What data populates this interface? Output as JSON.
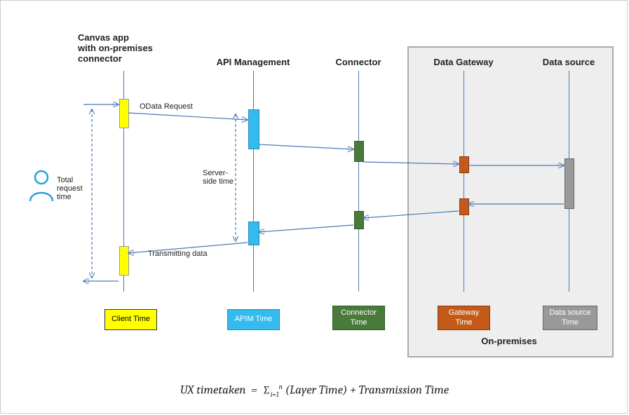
{
  "headers": {
    "canvas": "Canvas app\nwith on-premises\nconnector",
    "apim": "API Management",
    "connector": "Connector",
    "gateway": "Data Gateway",
    "datasource": "Data source"
  },
  "labels": {
    "odata_request": "OData Request",
    "server_side_time": "Server-\nside time",
    "total_request_time": "Total\nrequest\ntime",
    "transmitting_data": "Transmitting data",
    "on_premises": "On-premises"
  },
  "legends": {
    "client": "Client Time",
    "apim": "APIM Time",
    "connector": "Connector\nTime",
    "gateway": "Gateway\nTime",
    "datasource": "Data source\nTime"
  },
  "formula": {
    "lhs": "UX timetaken",
    "eq": "=",
    "sum_lower": "i=1",
    "sum_upper": "n",
    "term1": "(Layer Time)",
    "plus": "+",
    "term2": "Transmission Time"
  },
  "chart_data": {
    "type": "sequence-diagram",
    "participants": [
      {
        "id": "client",
        "label": "Canvas app with on-premises connector",
        "color": "#ffff00",
        "legend": "Client Time"
      },
      {
        "id": "apim",
        "label": "API Management",
        "color": "#33bbee",
        "legend": "APIM Time"
      },
      {
        "id": "connector",
        "label": "Connector",
        "color": "#4a7a3a",
        "legend": "Connector Time"
      },
      {
        "id": "gateway",
        "label": "Data Gateway",
        "color": "#c45a1a",
        "legend": "Gateway Time",
        "group": "on-premises"
      },
      {
        "id": "datasource",
        "label": "Data source",
        "color": "#999",
        "legend": "Data source Time",
        "group": "on-premises"
      }
    ],
    "group": {
      "id": "on-premises",
      "label": "On-premises"
    },
    "messages": [
      {
        "from": "user",
        "to": "client",
        "label": "",
        "direction": "request"
      },
      {
        "from": "client",
        "to": "apim",
        "label": "OData Request",
        "direction": "request"
      },
      {
        "from": "apim",
        "to": "connector",
        "label": "",
        "direction": "request"
      },
      {
        "from": "connector",
        "to": "gateway",
        "label": "",
        "direction": "request"
      },
      {
        "from": "gateway",
        "to": "datasource",
        "label": "",
        "direction": "request"
      },
      {
        "from": "datasource",
        "to": "gateway",
        "label": "",
        "direction": "response"
      },
      {
        "from": "gateway",
        "to": "connector",
        "label": "",
        "direction": "response"
      },
      {
        "from": "connector",
        "to": "apim",
        "label": "",
        "direction": "response"
      },
      {
        "from": "apim",
        "to": "client",
        "label": "Transmitting data",
        "direction": "response"
      },
      {
        "from": "client",
        "to": "user",
        "label": "",
        "direction": "response"
      }
    ],
    "spans": [
      {
        "id": "total_request_time",
        "label": "Total request time",
        "from_participant": "client",
        "covers": [
          "client-start",
          "client-end"
        ]
      },
      {
        "id": "server_side_time",
        "label": "Server-side time",
        "from_participant": "apim",
        "covers": [
          "apim-start",
          "apim-end"
        ]
      }
    ],
    "equation": "UX timetaken = Σ_{i=1}^{n} (Layer Time) + Transmission Time"
  }
}
